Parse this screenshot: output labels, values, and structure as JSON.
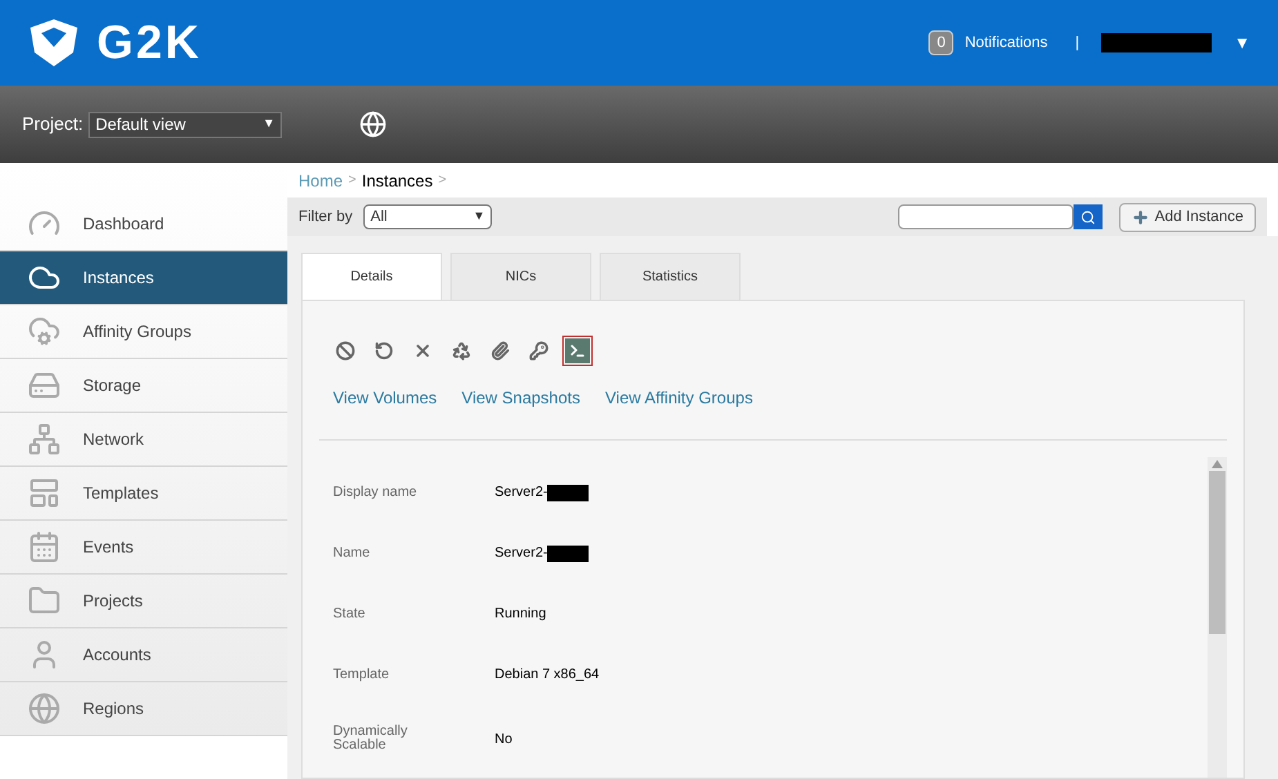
{
  "header": {
    "logo_text": "G2K",
    "notifications_count": "0",
    "notifications_label": "Notifications",
    "separator": "|",
    "user_redacted": true,
    "user_menu_caret": "▼"
  },
  "project_bar": {
    "label": "Project:",
    "select_value": "Default view",
    "select_caret": "▼"
  },
  "sidebar": {
    "items": [
      {
        "label": "Dashboard",
        "selected": false
      },
      {
        "label": "Instances",
        "selected": true
      },
      {
        "label": "Affinity Groups",
        "selected": false
      },
      {
        "label": "Storage",
        "selected": false
      },
      {
        "label": "Network",
        "selected": false
      },
      {
        "label": "Templates",
        "selected": false
      },
      {
        "label": "Events",
        "selected": false
      },
      {
        "label": "Projects",
        "selected": false
      },
      {
        "label": "Accounts",
        "selected": false
      },
      {
        "label": "Regions",
        "selected": false
      }
    ]
  },
  "breadcrumb": [
    {
      "label": "Home",
      "kind": "link"
    },
    {
      "label": "Instances",
      "kind": "current"
    }
  ],
  "breadcrumb_separator": ">",
  "filter": {
    "label": "Filter by",
    "value": "All",
    "caret": "▼"
  },
  "add_button": "Add Instance",
  "tabs": [
    {
      "label": "Details",
      "selected": true
    },
    {
      "label": "NICs",
      "selected": false
    },
    {
      "label": "Statistics",
      "selected": false
    }
  ],
  "links": [
    "View Volumes",
    "View Snapshots",
    "View Affinity Groups"
  ],
  "details": [
    {
      "label": "Display name",
      "value": "Server2-",
      "redacted": true
    },
    {
      "label": "Name",
      "value": "Server2-",
      "redacted": true
    },
    {
      "label": "State",
      "value": "Running",
      "redacted": false
    },
    {
      "label": "Template",
      "value": "Debian 7 x86_64",
      "redacted": false
    },
    {
      "label": "Dynamically Scalable",
      "value": "No",
      "redacted": false
    }
  ]
}
